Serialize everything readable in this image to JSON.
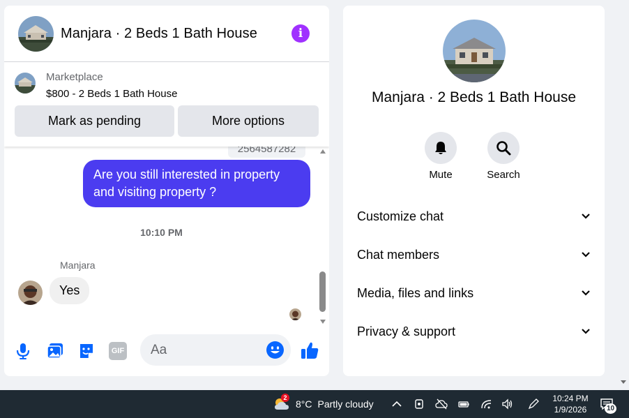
{
  "chat": {
    "title": "Manjara · 2 Beds 1 Bath House",
    "info_icon": "info-icon"
  },
  "marketplace": {
    "label": "Marketplace",
    "listing": "$800 - 2 Beds 1 Bath House",
    "mark_pending_label": "Mark as pending",
    "more_options_label": "More options"
  },
  "messages": {
    "phone_number": "2564587282",
    "outgoing_text": "Are you still interested in property and visiting property ?",
    "timestamp": "10:10 PM",
    "sender_name": "Manjara",
    "incoming_text": "Yes"
  },
  "composer": {
    "placeholder": "Aa",
    "icons": [
      "microphone-icon",
      "photo-icon",
      "sticker-icon",
      "gif-icon",
      "emoji-icon",
      "thumbs-up-icon"
    ],
    "gif_text": "GIF"
  },
  "info_panel": {
    "title": "Manjara · 2 Beds 1 Bath House",
    "actions": [
      {
        "label": "Mute",
        "icon": "bell-icon"
      },
      {
        "label": "Search",
        "icon": "search-icon"
      }
    ],
    "sections": [
      {
        "label": "Customize chat"
      },
      {
        "label": "Chat members"
      },
      {
        "label": "Media, files and links"
      },
      {
        "label": "Privacy & support"
      }
    ]
  },
  "taskbar": {
    "weather_temp": "8°C",
    "weather_desc": "Partly cloudy",
    "weather_badge": "2",
    "time": "10:24 PM",
    "date": "1/9/2026",
    "notification_count": "10"
  },
  "colors": {
    "accent": "#0866ff",
    "outgoing_bubble": "#4b3cf0",
    "info_icon": "#a031ff",
    "taskbar": "#1f2a33"
  }
}
